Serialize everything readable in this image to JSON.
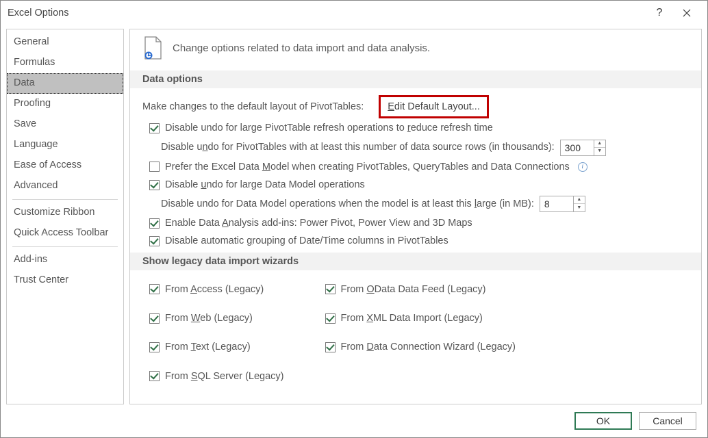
{
  "window": {
    "title": "Excel Options"
  },
  "sidebar": {
    "items_top": [
      {
        "label": "General"
      },
      {
        "label": "Formulas"
      },
      {
        "label": "Data",
        "selected": true
      },
      {
        "label": "Proofing"
      },
      {
        "label": "Save"
      },
      {
        "label": "Language"
      },
      {
        "label": "Ease of Access"
      },
      {
        "label": "Advanced"
      }
    ],
    "items_mid": [
      {
        "label": "Customize Ribbon"
      },
      {
        "label": "Quick Access Toolbar"
      }
    ],
    "items_bottom": [
      {
        "label": "Add-ins"
      },
      {
        "label": "Trust Center"
      }
    ]
  },
  "header": {
    "subtitle": "Change options related to data import and data analysis."
  },
  "section1": {
    "title": "Data options",
    "pivot_layout_label": "Make changes to the default layout of PivotTables:",
    "edit_default_btn": "Edit Default Layout...",
    "chk1": "Disable undo for large PivotTable refresh operations to reduce refresh time",
    "row2_label": "Disable undo for PivotTables with at least this number of data source rows (in thousands):",
    "row2_value": "300",
    "chk3": "Prefer the Excel Data Model when creating PivotTables, QueryTables and Data Connections",
    "chk4": "Disable undo for large Data Model operations",
    "row5_label": "Disable undo for Data Model operations when the model is at least this large (in MB):",
    "row5_value": "8",
    "chk6": "Enable Data Analysis add-ins: Power Pivot, Power View and 3D Maps",
    "chk7": "Disable automatic grouping of Date/Time columns in PivotTables"
  },
  "section2": {
    "title": "Show legacy data import wizards",
    "col1": [
      {
        "label": "From Access (Legacy)"
      },
      {
        "label": "From Web (Legacy)"
      },
      {
        "label": "From Text (Legacy)"
      },
      {
        "label": "From SQL Server (Legacy)"
      }
    ],
    "col2": [
      {
        "label": "From OData Data Feed (Legacy)"
      },
      {
        "label": "From XML Data Import (Legacy)"
      },
      {
        "label": "From Data Connection Wizard (Legacy)"
      }
    ]
  },
  "footer": {
    "ok": "OK",
    "cancel": "Cancel"
  }
}
